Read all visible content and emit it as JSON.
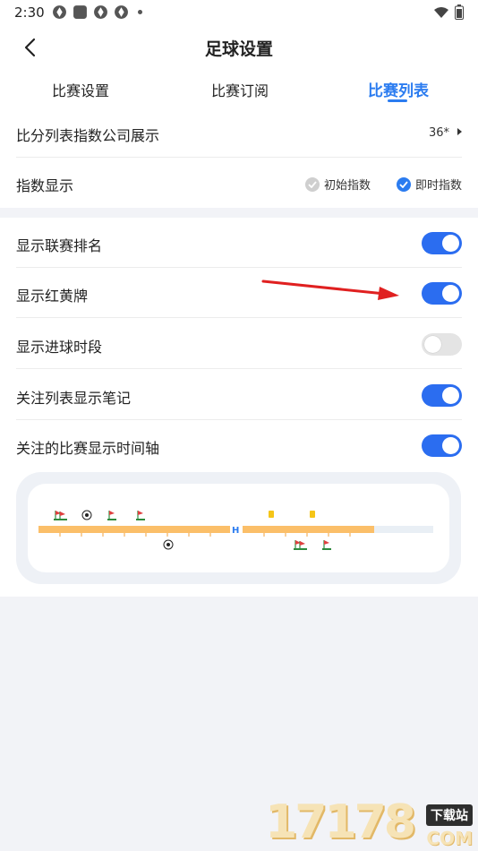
{
  "status_bar": {
    "time": "2:30"
  },
  "header": {
    "title": "足球设置",
    "back_icon": "chevron-left-icon"
  },
  "tabs": [
    {
      "label": "比赛设置",
      "active": false
    },
    {
      "label": "比赛订阅",
      "active": false
    },
    {
      "label": "比赛列表",
      "active": true
    }
  ],
  "settings": {
    "index_company": {
      "label": "比分列表指数公司展示",
      "value": "36*"
    },
    "index_display": {
      "label": "指数显示",
      "options": [
        {
          "label": "初始指数",
          "checked": false
        },
        {
          "label": "即时指数",
          "checked": true
        }
      ]
    }
  },
  "toggles": [
    {
      "label": "显示联赛排名",
      "on": true
    },
    {
      "label": "显示红黄牌",
      "on": true
    },
    {
      "label": "显示进球时段",
      "on": false
    },
    {
      "label": "关注列表显示笔记",
      "on": true
    },
    {
      "label": "关注的比赛显示时间轴",
      "on": true
    }
  ],
  "timeline_preview": {
    "halftime_marker": "H"
  },
  "watermark": {
    "number": "17178",
    "badge": "下载站",
    "domain": "COM"
  },
  "colors": {
    "accent": "#2b7cf0",
    "toggle_on": "#2b6df0",
    "toggle_off": "#e4e4e4",
    "timeline_bar": "#fbbf69",
    "annotation_arrow": "#e02020"
  }
}
